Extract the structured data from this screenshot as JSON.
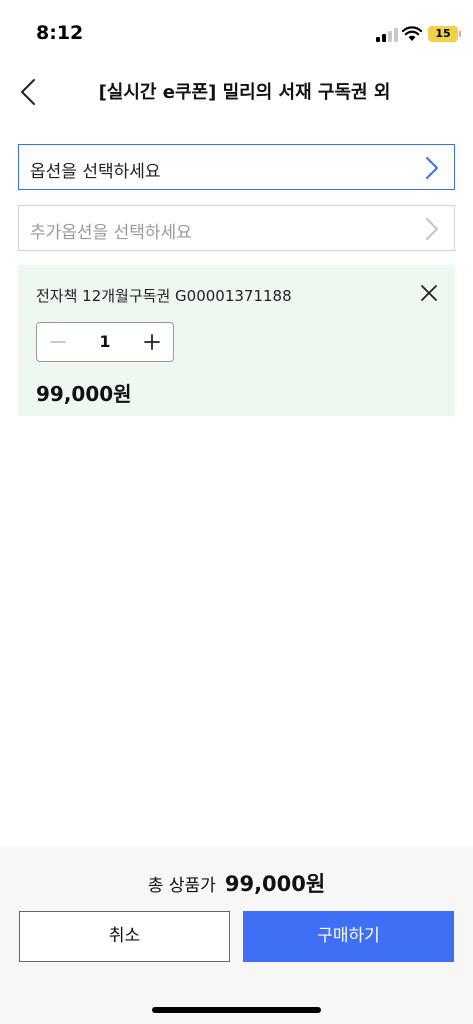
{
  "status_bar": {
    "time": "8:12",
    "battery_level": "15",
    "battery_color": "#f2d14a"
  },
  "header": {
    "title": "[실시간 e쿠폰] 밀리의 서재 구독권 외",
    "back_icon": "chevron-left-icon"
  },
  "options": {
    "primary_placeholder": "옵션을 선택하세요",
    "secondary_placeholder": "추가옵션을 선택하세요",
    "accent_color": "#3d6fe8"
  },
  "selected_item": {
    "name": "전자책 12개월구독권 G00001371188",
    "quantity": "1",
    "price": "99,000원",
    "panel_color": "#eef8f1"
  },
  "footer": {
    "total_label": "총 상품가",
    "total_value": "99,000원",
    "cancel_label": "취소",
    "buy_label": "구매하기",
    "buy_color": "#3e6ff5"
  }
}
